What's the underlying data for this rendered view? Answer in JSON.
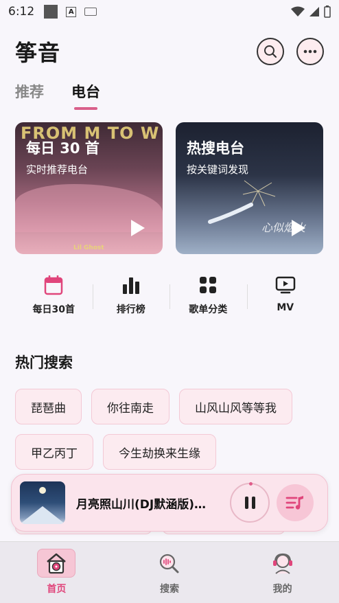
{
  "status_bar": {
    "time": "6:12"
  },
  "header": {
    "title": "筝音"
  },
  "tabs": [
    {
      "label": "推荐",
      "active": false
    },
    {
      "label": "电台",
      "active": true
    }
  ],
  "radio_cards": [
    {
      "title": "每日 30 首",
      "subtitle": "实时推荐电台",
      "banner": "FROM M TO W",
      "artist_tag": "Lil Ghost"
    },
    {
      "title": "热搜电台",
      "subtitle": "按关键词发现",
      "caption": "心似烟火"
    }
  ],
  "shortcuts": [
    {
      "label": "每日30首",
      "icon": "calendar-icon"
    },
    {
      "label": "排行榜",
      "icon": "bar-chart-icon"
    },
    {
      "label": "歌单分类",
      "icon": "grid-icon"
    },
    {
      "label": "MV",
      "icon": "tv-play-icon"
    }
  ],
  "hot_search": {
    "title": "热门搜索",
    "chips": [
      "琵琶曲",
      "你往南走",
      "山风山风等等我",
      "甲乙丙丁",
      "今生劫换来生缘"
    ]
  },
  "player": {
    "song_title": "月亮照山川(DJ默涵版)…"
  },
  "bottom_nav": [
    {
      "label": "首页",
      "active": true,
      "icon": "home-icon"
    },
    {
      "label": "搜索",
      "active": false,
      "icon": "search-music-icon"
    },
    {
      "label": "我的",
      "active": false,
      "icon": "profile-icon"
    }
  ],
  "colors": {
    "accent": "#e0457b",
    "chip_bg": "#fcebf0",
    "background": "#f8f6fb"
  }
}
